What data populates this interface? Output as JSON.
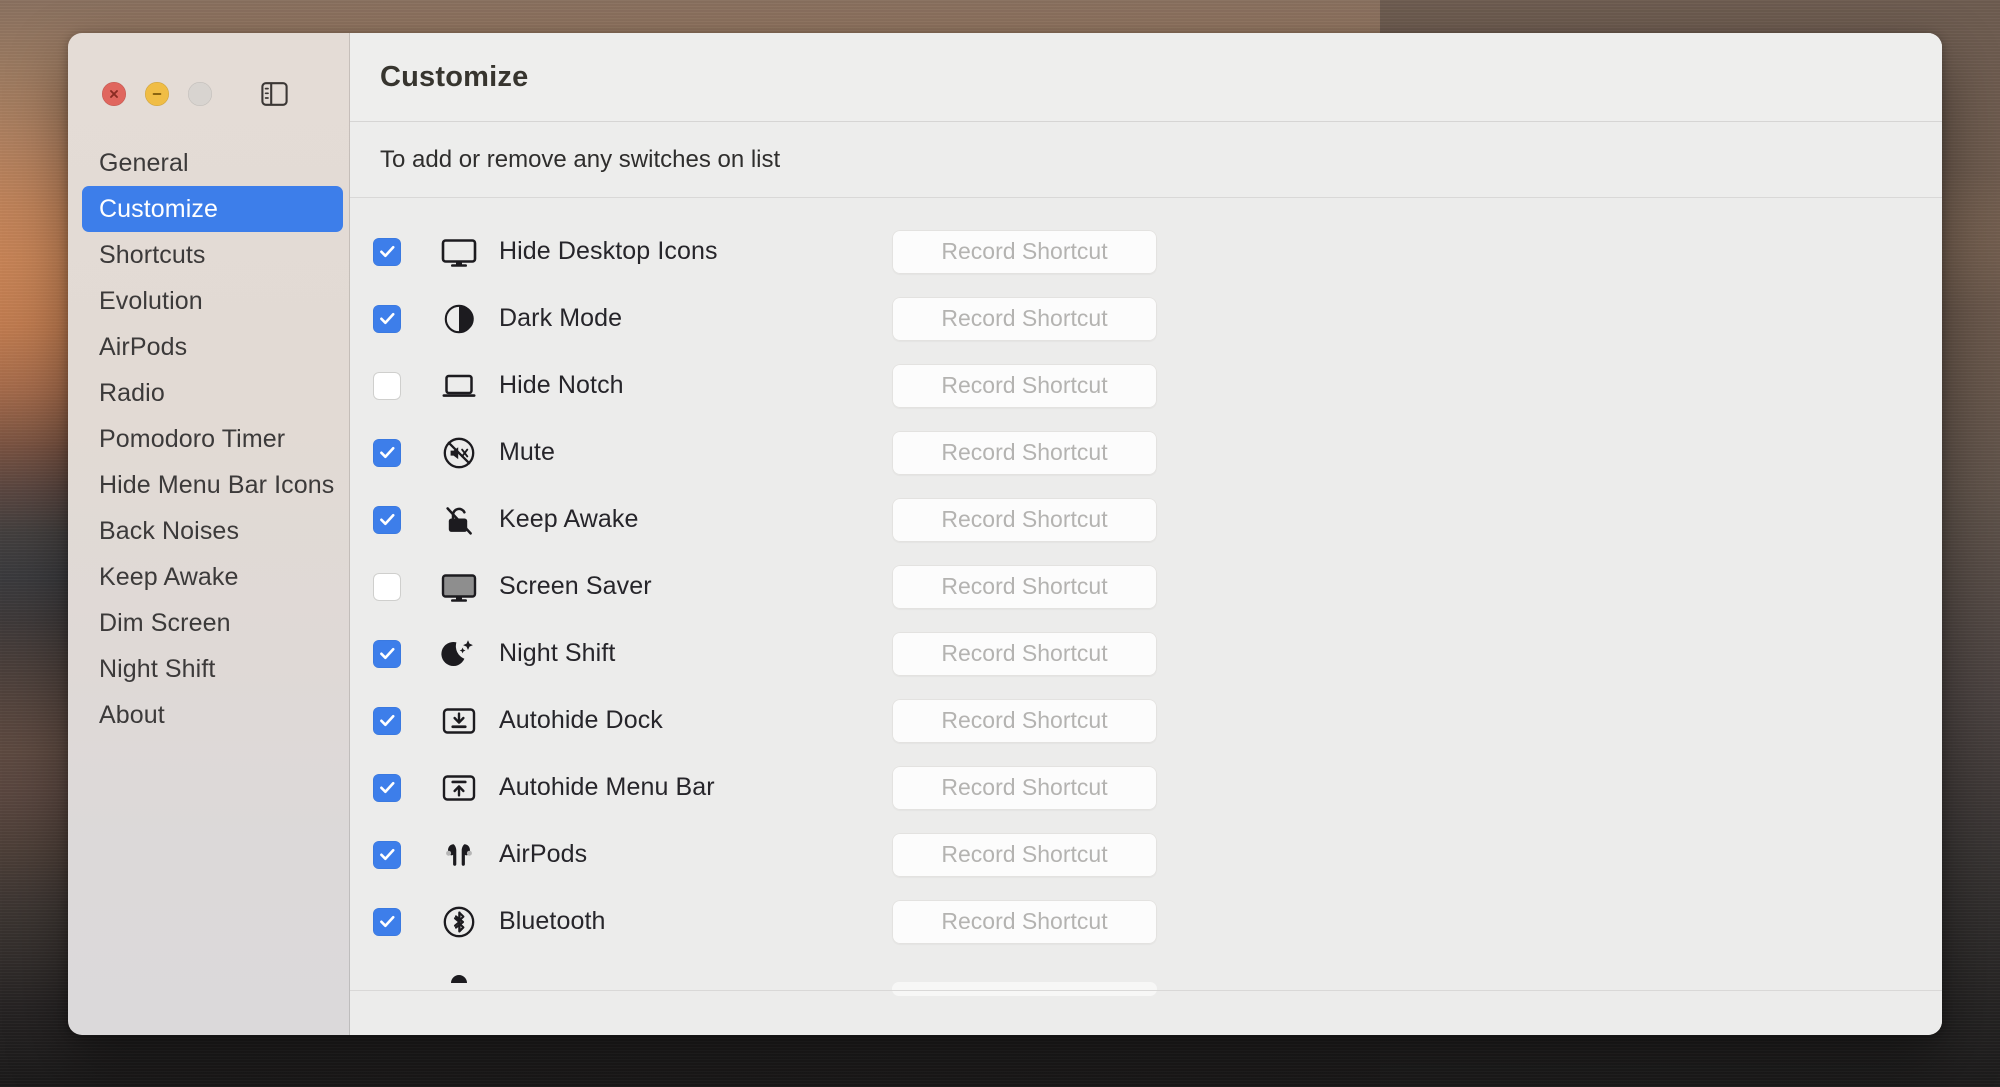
{
  "window": {
    "traffic_lights": [
      {
        "name": "close",
        "color": "#e0665e",
        "glyph": "×"
      },
      {
        "name": "minimize",
        "color": "#f0bd45",
        "glyph": "−"
      },
      {
        "name": "zoom",
        "color": "#d8d4d0",
        "glyph": ""
      }
    ],
    "sidebar_toggle_icon": "sidebar-toggle-icon"
  },
  "sidebar": {
    "background": "#e2dad4",
    "selected_color": "#3d7eea",
    "items": [
      {
        "label": "General",
        "selected": false
      },
      {
        "label": "Customize",
        "selected": true
      },
      {
        "label": "Shortcuts",
        "selected": false
      },
      {
        "label": "Evolution",
        "selected": false
      },
      {
        "label": "AirPods",
        "selected": false
      },
      {
        "label": "Radio",
        "selected": false
      },
      {
        "label": "Pomodoro Timer",
        "selected": false
      },
      {
        "label": "Hide Menu Bar Icons",
        "selected": false
      },
      {
        "label": "Back Noises",
        "selected": false
      },
      {
        "label": "Keep Awake",
        "selected": false
      },
      {
        "label": "Dim Screen",
        "selected": false
      },
      {
        "label": "Night Shift",
        "selected": false
      },
      {
        "label": "About",
        "selected": false
      }
    ]
  },
  "header": {
    "title": "Customize",
    "subtitle": "To add or remove any switches on list"
  },
  "list": {
    "shortcut_button_label": "Record Shortcut",
    "rows": [
      {
        "label": "Hide Desktop Icons",
        "checked": true,
        "icon": "display-icon"
      },
      {
        "label": "Dark Mode",
        "checked": true,
        "icon": "circle-half-filled-icon"
      },
      {
        "label": "Hide Notch",
        "checked": false,
        "icon": "laptop-icon"
      },
      {
        "label": "Mute",
        "checked": true,
        "icon": "speaker-slash-circle-icon"
      },
      {
        "label": "Keep Awake",
        "checked": true,
        "icon": "lock-open-slash-icon"
      },
      {
        "label": "Screen Saver",
        "checked": false,
        "icon": "display-filled-icon"
      },
      {
        "label": "Night Shift",
        "checked": true,
        "icon": "moon-stars-icon"
      },
      {
        "label": "Autohide Dock",
        "checked": true,
        "icon": "arrow-down-to-line-box-icon"
      },
      {
        "label": "Autohide Menu Bar",
        "checked": true,
        "icon": "arrow-up-to-line-box-icon"
      },
      {
        "label": "AirPods",
        "checked": true,
        "icon": "airpods-icon"
      },
      {
        "label": "Bluetooth",
        "checked": true,
        "icon": "bluetooth-circle-icon"
      },
      {
        "label": "",
        "checked": true,
        "icon": "partial-row-icon"
      }
    ]
  }
}
